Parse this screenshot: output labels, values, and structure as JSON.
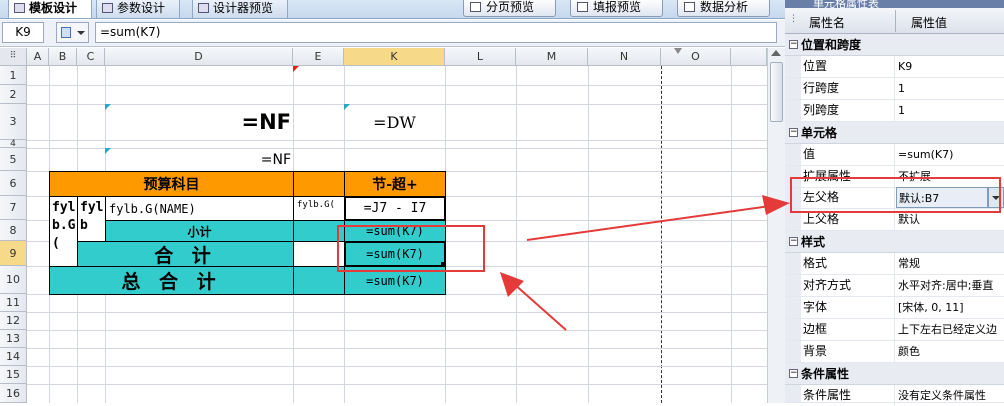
{
  "tabs": [
    {
      "label": "模板设计",
      "active": true
    },
    {
      "label": "参数设计",
      "active": false
    },
    {
      "label": "设计器预览",
      "active": false
    }
  ],
  "toolbar": {
    "page_preview": "分页预览",
    "fill_preview": "填报预览",
    "data_analysis": "数据分析"
  },
  "formula_bar": {
    "cell_ref": "K9",
    "formula": "=sum(K7)"
  },
  "grid": {
    "columns": [
      "A",
      "B",
      "C",
      "D",
      "E",
      "K",
      "L",
      "M",
      "N",
      "O"
    ],
    "rows": [
      "1",
      "2",
      "3",
      "4",
      "5",
      "6",
      "7",
      "8",
      "9",
      "10",
      "11",
      "12",
      "13",
      "14",
      "15",
      "16"
    ],
    "cells": {
      "d3": "=NF",
      "k3": "=DW",
      "d5": "=NF",
      "d6": "预算科目",
      "k6": "节-超+",
      "b7": "fylb.G(",
      "c7": "fylb",
      "d7": "fylb.G(NAME)",
      "e7": "fylb.G(",
      "k7": "=J7 - I7",
      "d8": "小计",
      "k8": "=sum(K7)",
      "c9": "合 计",
      "k9": "=sum(K7)",
      "b10": "总 合 计",
      "k10": "=sum(K7)"
    }
  },
  "panel": {
    "title": "单元格属性表",
    "header_name": "属性名",
    "header_value": "属性值",
    "categories": [
      {
        "name": "位置和跨度",
        "items": [
          {
            "k": "位置",
            "v": "K9"
          },
          {
            "k": "行跨度",
            "v": "1"
          },
          {
            "k": "列跨度",
            "v": "1"
          }
        ]
      },
      {
        "name": "单元格",
        "items": [
          {
            "k": "值",
            "v": "=sum(K7)"
          },
          {
            "k": "扩展属性",
            "v": "不扩展"
          },
          {
            "k": "左父格",
            "v": "默认:B7"
          },
          {
            "k": "上父格",
            "v": "默认"
          }
        ]
      },
      {
        "name": "样式",
        "items": [
          {
            "k": "格式",
            "v": "常规"
          },
          {
            "k": "对齐方式",
            "v": "水平对齐:居中;垂直"
          },
          {
            "k": "字体",
            "v": "[宋体, 0, 11]"
          },
          {
            "k": "边框",
            "v": "上下左右已经定义边"
          },
          {
            "k": "背景",
            "v": "颜色"
          }
        ]
      },
      {
        "name": "条件属性",
        "items": [
          {
            "k": "条件属性",
            "v": "没有定义条件属性"
          }
        ]
      }
    ]
  },
  "colors": {
    "orange": "#ff9900",
    "teal": "#33cccc",
    "highlight": "#e53a3a",
    "selected_header": "#f7d98a"
  }
}
